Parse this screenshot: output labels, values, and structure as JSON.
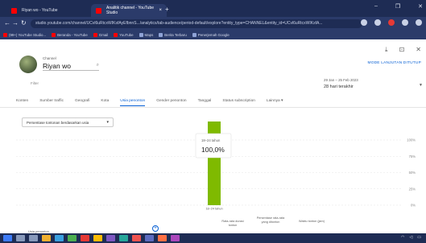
{
  "browser": {
    "tabs": [
      {
        "label": "Riyan wo - YouTube",
        "active": false
      },
      {
        "label": "Analitik channel - YouTube Studio",
        "active": true
      }
    ],
    "url": "studio.youtube.com/channel/UCvl6uRtcxWIKsfAyEfbnnS.../analytics/tab-audience/period-default/explore?entity_type=CHANNEL&entity_id=UCvl6uRtcxWIKsfA...",
    "bookmarks": [
      "(99+) YouTube Studio...",
      "Beranda - YouTube",
      "Gmail",
      "YouTube",
      "Maps",
      "Berita Terbaru",
      "Penerjemah Google"
    ]
  },
  "header": {
    "channel_label": "Channel",
    "channel_name": "Riyan wo",
    "advanced_mode": "MODE LANJUTAN DITUTUP",
    "filter_text": "Filter",
    "date_range": "29 Jan – 25 Feb 2023",
    "date_period": "28 hari terakhir"
  },
  "tabs": [
    "Konten",
    "Sumber traffic",
    "Geografi",
    "Kota",
    "Usia penonton",
    "Gender penonton",
    "Tanggal",
    "Status subscription",
    "Lainnya"
  ],
  "active_tab_index": 4,
  "metric_dropdown": "Persentase tontonan berdasarkan usia",
  "colors": {
    "bar": "#7fba00",
    "accent": "#065fd4",
    "tab_strip": "#1e2c54",
    "toolbar": "#2b3b6a"
  },
  "chart_data": {
    "type": "bar",
    "categories": [
      "18–24 tahun"
    ],
    "values": [
      100.0
    ],
    "tooltip_label": "18–24 tahun",
    "tooltip_value": "100,0%",
    "ytick_labels": [
      "100%",
      "75%",
      "50%",
      "25%",
      "0%"
    ],
    "ylim": [
      0,
      100
    ]
  },
  "table_headers": [
    "Rata-rata durasi tonton",
    "Persentase rata-rata yang ditonton",
    "Waktu tonton (jam)"
  ],
  "bottom_left_label": "Usia penonton"
}
